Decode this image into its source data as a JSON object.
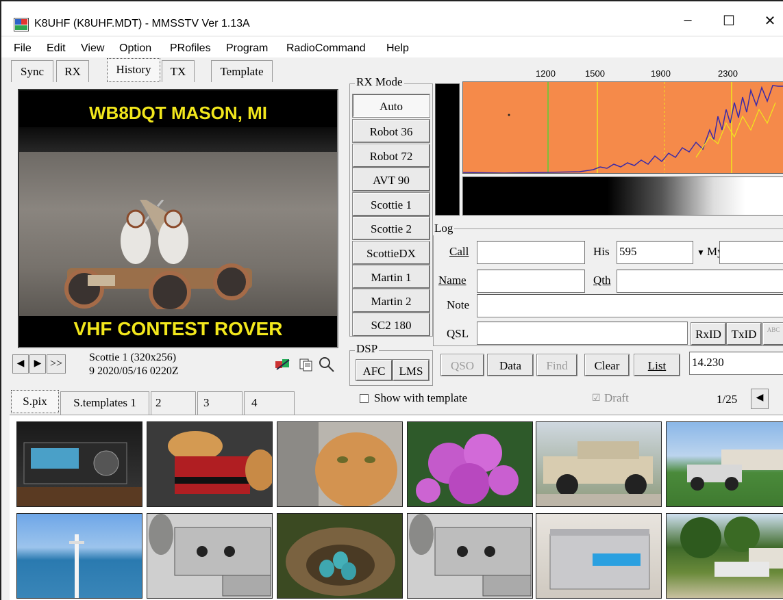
{
  "window": {
    "title": "K8UHF (K8UHF.MDT) - MMSSTV Ver 1.13A",
    "minimize": "–",
    "maximize": "☐",
    "close": "✕"
  },
  "menu": [
    "File",
    "Edit",
    "View",
    "Option",
    "PRofiles",
    "Program",
    "RadioCommand",
    "Help"
  ],
  "top_tabs": [
    "Sync",
    "RX",
    "History",
    "TX",
    "Template"
  ],
  "selected_top_tab": "History",
  "image": {
    "top_text": "WB8DQT  MASON, MI",
    "bottom_text": "VHF CONTEST ROVER"
  },
  "image_info": {
    "mode_line": "Scottie 1 (320x256)",
    "date_line": "9 2020/05/16 0220Z",
    "prev": "◀",
    "next": "▶",
    "last": ">>"
  },
  "rx_mode": {
    "label": "RX Mode",
    "modes": [
      "Auto",
      "Robot 36",
      "Robot 72",
      "AVT 90",
      "Scottie 1",
      "Scottie 2",
      "ScottieDX",
      "Martin 1",
      "Martin 2",
      "SC2 180"
    ],
    "selected": "Auto"
  },
  "dsp": {
    "label": "DSP",
    "afc": "AFC",
    "lms": "LMS"
  },
  "spectrum": {
    "freq_labels": [
      "1200",
      "1500",
      "1900",
      "2300"
    ]
  },
  "log": {
    "label": "Log",
    "call_label": "Call",
    "call_value": "",
    "his_label": "His",
    "his_value": "595",
    "my_label": "My",
    "my_value": "",
    "name_label": "Name",
    "name_value": "",
    "qth_label": "Qth",
    "qth_value": "",
    "note_label": "Note",
    "note_value": "",
    "qsl_label": "QSL",
    "qsl_value": "",
    "rxid": "RxID",
    "txid": "TxID",
    "abc": "ABC"
  },
  "actions": {
    "qso": "QSO",
    "data": "Data",
    "find": "Find",
    "clear": "Clear",
    "list": "List",
    "freq_value": "14.230"
  },
  "bottom_tabs": [
    "S.pix",
    "S.templates 1",
    "2",
    "3",
    "4"
  ],
  "show_with_template": "Show with template",
  "draft": "Draft",
  "page_counter": "1/25",
  "colors": {
    "accent_yellow": "#f2e71c",
    "spectrum_orange": "#f58a4a",
    "spectrum_line": "#3a2aa8"
  },
  "thumbnails": [
    {
      "name": "radio-transceiver-photo",
      "icon": "radio"
    },
    {
      "name": "cat-on-bag-photo",
      "icon": "cat"
    },
    {
      "name": "orange-cat-photo",
      "icon": "cat"
    },
    {
      "name": "pink-flowers-photo",
      "icon": "flowers"
    },
    {
      "name": "jeep-photo",
      "icon": "jeep"
    },
    {
      "name": "truck-camper-photo",
      "icon": "truck"
    },
    {
      "name": "ocean-antenna-photo",
      "icon": "ocean"
    },
    {
      "name": "vintage-radio-photo",
      "icon": "radio"
    },
    {
      "name": "bird-nest-eggs-photo",
      "icon": "nest"
    },
    {
      "name": "vintage-radio-2-photo",
      "icon": "radio"
    },
    {
      "name": "amplifier-box-photo",
      "icon": "amplifier"
    },
    {
      "name": "trees-camper-photo",
      "icon": "trees"
    }
  ]
}
